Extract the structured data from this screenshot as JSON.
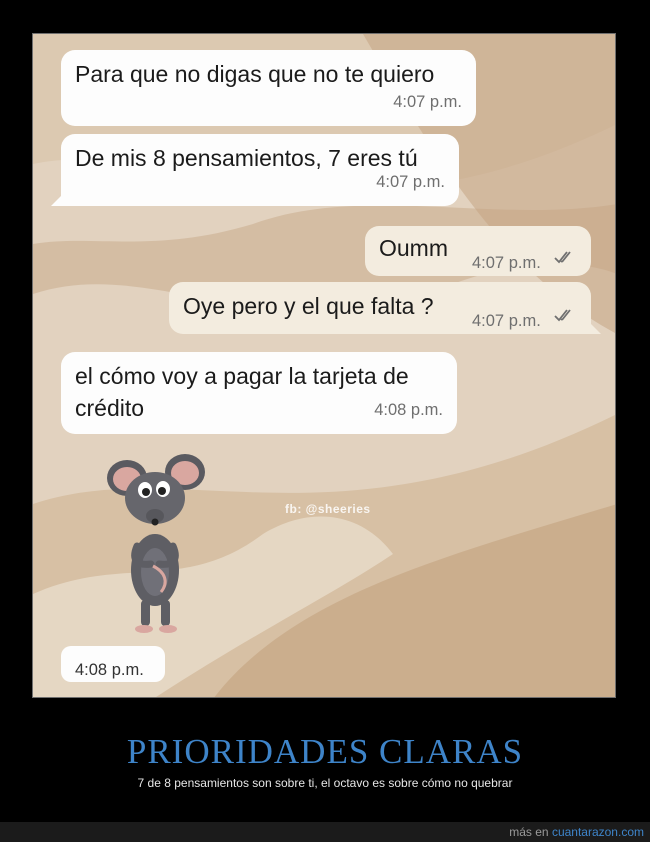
{
  "chat": {
    "messages": [
      {
        "direction": "incoming",
        "text": "Para que no digas que no te quiero",
        "time": "4:07 p.m."
      },
      {
        "direction": "incoming",
        "text": "De mis 8 pensamientos, 7 eres tú",
        "time": "4:07 p.m."
      },
      {
        "direction": "outgoing",
        "text": "Oumm",
        "time": "4:07 p.m.",
        "status": "read"
      },
      {
        "direction": "outgoing",
        "text": "Oye pero y el que falta ?",
        "time": "4:07 p.m.",
        "status": "read"
      },
      {
        "direction": "incoming",
        "text_line1": "el cómo voy a pagar la tarjeta de",
        "text_line2": "crédito",
        "time": "4:08 p.m."
      },
      {
        "direction": "incoming",
        "type": "sticker",
        "sticker": "mouse-sticker",
        "time": "4:08 p.m."
      }
    ],
    "watermark": "fb: @sheeries",
    "colors": {
      "incoming_bubble": "#fdfdfd",
      "outgoing_bubble": "#f3ecdf",
      "wallpaper": "#e2d2bf"
    }
  },
  "post": {
    "title": "PRIORIDADES CLARAS",
    "subtitle": "7 de 8 pensamientos son sobre ti, el octavo es sobre cómo no quebrar"
  },
  "footer": {
    "prefix": "más en",
    "site": "cuantarazon.com"
  }
}
